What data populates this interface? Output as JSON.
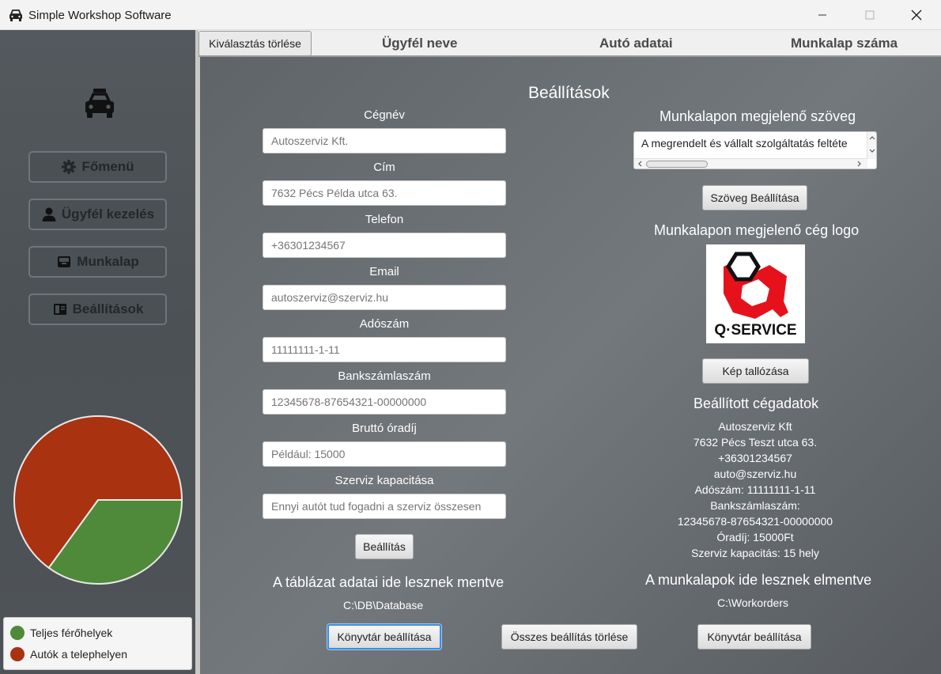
{
  "window": {
    "title": "Simple Workshop Software",
    "app_icon": "car-icon",
    "controls": [
      "minimize-icon",
      "maximize-icon",
      "close-icon"
    ]
  },
  "sidebar": {
    "logo_icon": "car-icon",
    "nav": [
      {
        "label": "Főmenü",
        "icon": "gear-icon"
      },
      {
        "label": "Ügyfél kezelés",
        "icon": "user-icon"
      },
      {
        "label": "Munkalap",
        "icon": "inbox-icon"
      },
      {
        "label": "Beállítások",
        "icon": "book-icon"
      }
    ],
    "chart_data": {
      "type": "pie",
      "title": "",
      "series": [
        {
          "name": "Teljes férőhelyek",
          "value": 35,
          "color": "#4e8a3a"
        },
        {
          "name": "Autók a telephelyen",
          "value": 65,
          "color": "#a93211"
        }
      ],
      "legend": "bottom"
    },
    "legend": [
      {
        "label": "Teljes férőhelyek",
        "color": "#4e8a3a"
      },
      {
        "label": "Autók a telephelyen",
        "color": "#a93211"
      }
    ]
  },
  "tabs": {
    "clear_selection": "Kiválasztás törlése",
    "headers": [
      "Ügyfél neve",
      "Autó adatai",
      "Munkalap száma"
    ]
  },
  "settings": {
    "title": "Beállítások",
    "fields": [
      {
        "label": "Cégnév",
        "placeholder": "Autoszerviz Kft."
      },
      {
        "label": "Cím",
        "placeholder": "7632 Pécs Példa utca 63."
      },
      {
        "label": "Telefon",
        "placeholder": "+36301234567"
      },
      {
        "label": "Email",
        "placeholder": "autoszerviz@szerviz.hu"
      },
      {
        "label": "Adószám",
        "placeholder": "11111111-1-11"
      },
      {
        "label": "Bankszámlaszám",
        "placeholder": "12345678-87654321-00000000"
      },
      {
        "label": "Bruttó óradíj",
        "placeholder": "Például: 15000"
      },
      {
        "label": "Szerviz kapacitása",
        "placeholder": "Ennyi autót tud fogadni a szerviz összesen"
      }
    ],
    "submit_label": "Beállítás",
    "worksheet_text_title": "Munkalapon megjelenő szöveg",
    "worksheet_text_value": "A megrendelt és vállalt szolgáltatás feltéte",
    "set_text_label": "Szöveg Beállítása",
    "logo_title": "Munkalapon megjelenő cég logo",
    "logo_text": "Q·SERVICE",
    "browse_image_label": "Kép tallózása",
    "current_data_title": "Beállított cégadatok",
    "current_data": [
      "Autoszerviz Kft",
      "7632 Pécs Teszt utca 63.",
      "+36301234567",
      "auto@szerviz.hu",
      "Adószám: 11111111-1-11",
      "Bankszámlaszám:",
      "12345678-87654321-00000000",
      "Óradíj: 15000Ft",
      "Szerviz kapacitás: 15 hely"
    ],
    "db_title": "A táblázat adatai ide lesznek mentve",
    "db_path": "C:\\DB\\Database",
    "workorders_title": "A munkalapok ide lesznek elmentve",
    "workorders_path": "C:\\Workorders",
    "dir_button_label": "Könyvtár beállítása",
    "delete_all_label": "Összes beállítás törlése",
    "dir_button2_label": "Könyvtár beállítása"
  }
}
